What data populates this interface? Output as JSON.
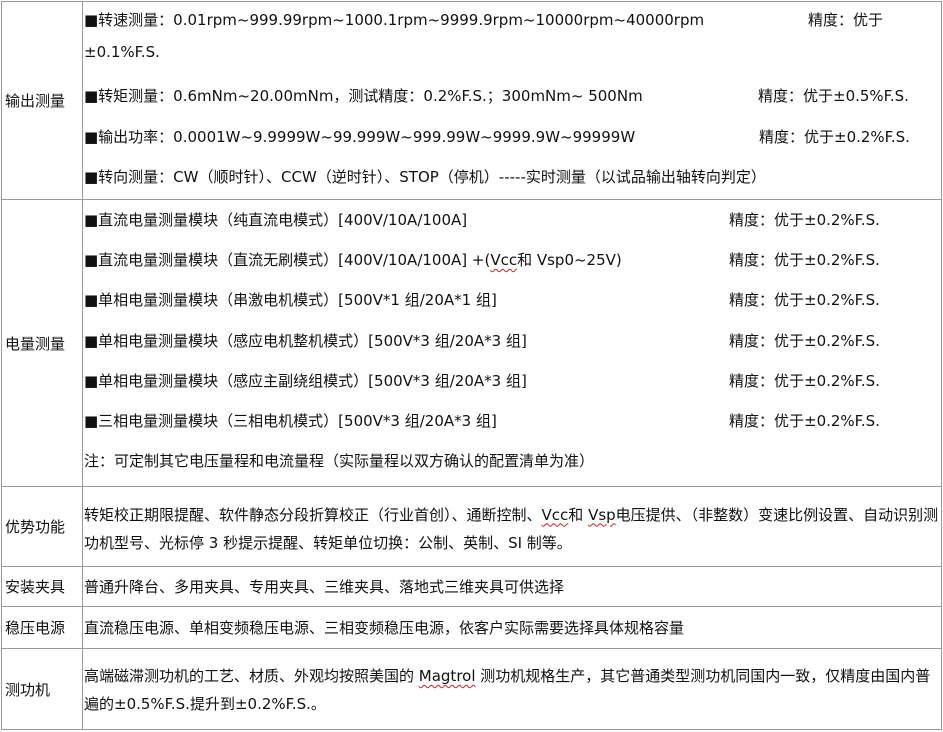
{
  "rows": {
    "output": {
      "label": "输出测量",
      "lines": [
        {
          "text": "■转速测量：0.01rpm~999.99rpm~1000.1rpm~9999.9rpm~10000rpm~40000rpm",
          "precision": "精度：优于"
        },
        {
          "text": "±0.1%F.S.",
          "precision": ""
        },
        {
          "text": "■转矩测量：0.6mNm~20.00mNm，测试精度：0.2%F.S.；300mNm~ 500Nm",
          "precision": "精度：优于±0.5%F.S."
        },
        {
          "text": "■输出功率：0.0001W~9.9999W~99.999W~999.99W~9999.9W~99999W",
          "precision": "精度：优于±0.2%F.S."
        },
        {
          "text": "■转向测量：CW（顺时针）、CCW（逆时针）、STOP（停机）-----实时测量（以试品输出轴转向判定）",
          "precision": ""
        }
      ]
    },
    "power": {
      "label": "电量测量",
      "lines": [
        {
          "text": "■直流电量测量模块（纯直流电模式）[400V/10A/100A]",
          "precision": "精度：优于±0.2%F.S."
        },
        {
          "text_a": "■直流电量测量模块（直流无刷模式）[400V/10A/100A] +(",
          "text_wavy": "Vcc",
          "text_b": "和 Vsp0~25V)",
          "precision": "精度：优于±0.2%F.S."
        },
        {
          "text": "■单相电量测量模块（串激电机模式）[500V*1 组/20A*1 组]",
          "precision": "精度：优于±0.2%F.S."
        },
        {
          "text": "■单相电量测量模块（感应电机整机模式）[500V*3 组/20A*3 组]",
          "precision": "精度：优于±0.2%F.S."
        },
        {
          "text": "■单相电量测量模块（感应主副绕组模式）[500V*3 组/20A*3 组]",
          "precision": "精度：优于±0.2%F.S."
        },
        {
          "text": "■三相电量测量模块（三相电机模式）[500V*3 组/20A*3 组]",
          "precision": "精度：优于±0.2%F.S."
        },
        {
          "text": "注：可定制其它电压量程和电流量程（实际量程以双方确认的配置清单为准）",
          "precision": ""
        }
      ]
    },
    "advantage": {
      "label": "优势功能",
      "text_a": "转矩校正期限提醒、软件静态分段折算校正（行业首创）、通断控制、",
      "wavy1": "Vcc",
      "text_b": "和 ",
      "wavy2": "Vsp",
      "text_c": "电压提供、（非整数）变速比例设置、自动识别测功机型号、光标停 3 秒提示提醒、转矩单位切换：公制、英制、SI 制等。"
    },
    "fixture": {
      "label": "安装夹具",
      "text": "普通升降台、多用夹具、专用夹具、三维夹具、落地式三维夹具可供选择"
    },
    "regulator": {
      "label": "稳压电源",
      "text": "直流稳压电源、单相变频稳压电源、三相变频稳压电源，依客户实际需要选择具体规格容量"
    },
    "dyno": {
      "label": "测功机",
      "text_a": "高端磁滞测功机的工艺、材质、外观均按照美国的 ",
      "wavy": "Magtrol",
      "text_b": " 测功机规格生产，其它普通类型测功机同国内一致，仅精度由国内普遍的±0.5%F.S.提升到±0.2%F.S.。"
    }
  }
}
